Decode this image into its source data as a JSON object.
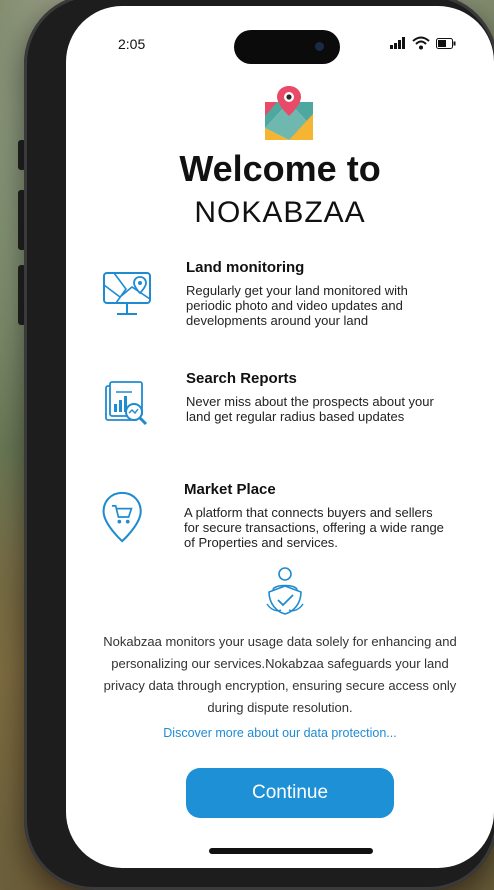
{
  "status_bar": {
    "time": "2:05"
  },
  "welcome": {
    "title": "Welcome to",
    "brand": "NOKABZAA"
  },
  "features": [
    {
      "title": "Land monitoring",
      "description": "Regularly get your land monitored with periodic photo and video updates and developments around your land",
      "icon": "map-monitor-icon"
    },
    {
      "title": "Search Reports",
      "description": "Never miss about the prospects about your land get regular radius based updates",
      "icon": "search-report-icon"
    },
    {
      "title": "Market Place",
      "description": "A platform that connects buyers and sellers for secure transactions, offering a wide range of  Properties and services.",
      "icon": "cart-pin-icon"
    }
  ],
  "privacy": {
    "text": "Nokabzaa monitors your usage data solely for enhancing and personalizing our services.Nokabzaa safeguards your land privacy data through encryption, ensuring secure access only during dispute resolution.",
    "link": "Discover more about our  data protection..."
  },
  "continue_label": "Continue",
  "colors": {
    "accent": "#1e90d6",
    "icon_blue": "#1f8bd1"
  }
}
